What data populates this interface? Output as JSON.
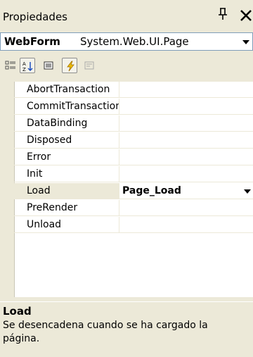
{
  "window": {
    "title": "Propiedades"
  },
  "object_selector": {
    "name": "WebForm",
    "type": "System.Web.UI.Page"
  },
  "toolbar": {
    "buttons": [
      {
        "name": "categorized-icon",
        "pressed": false
      },
      {
        "name": "alphabetical-icon",
        "pressed": true
      },
      {
        "name": "properties-icon",
        "pressed": false
      },
      {
        "name": "events-icon",
        "pressed": true
      },
      {
        "name": "property-pages-icon",
        "pressed": false
      }
    ]
  },
  "events": [
    {
      "name": "AbortTransaction",
      "value": ""
    },
    {
      "name": "CommitTransaction",
      "value": ""
    },
    {
      "name": "DataBinding",
      "value": ""
    },
    {
      "name": "Disposed",
      "value": ""
    },
    {
      "name": "Error",
      "value": ""
    },
    {
      "name": "Init",
      "value": ""
    },
    {
      "name": "Load",
      "value": "Page_Load"
    },
    {
      "name": "PreRender",
      "value": ""
    },
    {
      "name": "Unload",
      "value": ""
    }
  ],
  "selected_index": 6,
  "description": {
    "title": "Load",
    "text": "Se desencadena cuando se ha cargado la página."
  },
  "colors": {
    "panel": "#ece9d8",
    "border": "#7f9db9",
    "lightning": "#f0c000"
  }
}
